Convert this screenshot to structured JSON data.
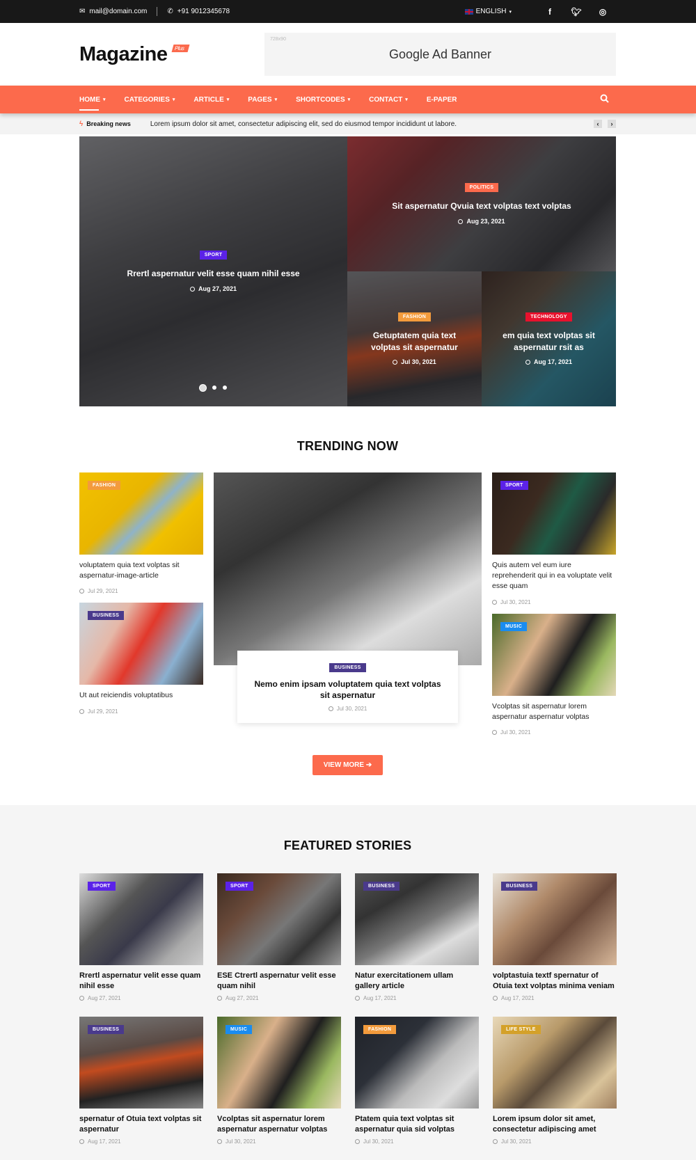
{
  "topbar": {
    "email": "mail@domain.com",
    "phone": "+91 9012345678",
    "language": "ENGLISH",
    "social": [
      "f",
      "t",
      "ig"
    ]
  },
  "header": {
    "logo": "Magazine",
    "logo_badge": "Plus",
    "ad_size": "728x90",
    "ad_text": "Google Ad Banner"
  },
  "nav": {
    "items": [
      {
        "label": "HOME",
        "dropdown": true,
        "active": true
      },
      {
        "label": "CATEGORIES",
        "dropdown": true
      },
      {
        "label": "ARTICLE",
        "dropdown": true
      },
      {
        "label": "PAGES",
        "dropdown": true
      },
      {
        "label": "SHORTCODES",
        "dropdown": true
      },
      {
        "label": "CONTACT",
        "dropdown": true
      },
      {
        "label": "E-PAPER",
        "dropdown": false
      }
    ]
  },
  "breaking": {
    "label": "Breaking news",
    "text": "Lorem ipsum dolor sit amet, consectetur adipiscing elit, sed do eiusmod tempor incididunt ut labore."
  },
  "colors": {
    "accent": "#fc6a4c",
    "sport": "#5b22e8",
    "politics": "#fc6a4c",
    "fashion": "#f39b3c",
    "technology": "#e8112d",
    "business": "#4a3a8c",
    "music": "#1a8cf0",
    "lifestyle": "#d4a12a"
  },
  "hero": [
    {
      "category": "SPORT",
      "title": "Rrertl aspernatur velit esse quam nihil esse",
      "date": "Aug 27, 2021"
    },
    {
      "category": "POLITICS",
      "title": "Sit aspernatur Qvuia text volptas text volptas",
      "date": "Aug 23, 2021"
    },
    {
      "category": "FASHION",
      "title": "Getuptatem quia text volptas sit aspernatur",
      "date": "Jul 30, 2021"
    },
    {
      "category": "TECHNOLOGY",
      "title": "em quia text volptas sit aspernatur rsit as",
      "date": "Aug 17, 2021"
    }
  ],
  "trending": {
    "title": "TRENDING NOW",
    "left": [
      {
        "category": "FASHION",
        "title": "voluptatem quia text volptas sit aspernatur-image-article",
        "date": "Jul 29, 2021"
      },
      {
        "category": "BUSINESS",
        "title": "Ut aut reiciendis voluptatibus",
        "date": "Jul 29, 2021"
      }
    ],
    "center": {
      "category": "BUSINESS",
      "title": "Nemo enim ipsam voluptatem quia text volptas sit aspernatur",
      "date": "Jul 30, 2021"
    },
    "right": [
      {
        "category": "SPORT",
        "title": "Quis autem vel eum iure reprehenderit qui in ea voluptate velit esse quam",
        "date": "Jul 30, 2021"
      },
      {
        "category": "MUSIC",
        "title": "Vcolptas sit aspernatur lorem aspernatur aspernatur volptas",
        "date": "Jul 30, 2021"
      }
    ],
    "view_more": "VIEW MORE"
  },
  "featured": {
    "title": "FEATURED STORIES",
    "items": [
      {
        "category": "SPORT",
        "title": "Rrertl aspernatur velit esse quam nihil esse",
        "date": "Aug 27, 2021"
      },
      {
        "category": "SPORT",
        "title": "ESE Ctrertl aspernatur velit esse quam nihil",
        "date": "Aug 27, 2021"
      },
      {
        "category": "BUSINESS",
        "title": "Natur exercitationem ullam gallery article",
        "date": "Aug 17, 2021"
      },
      {
        "category": "BUSINESS",
        "title": "volptastuia textf spernatur of Otuia text volptas minima veniam",
        "date": "Aug 17, 2021"
      },
      {
        "category": "BUSINESS",
        "title": "spernatur of Otuia text volptas sit aspernatur",
        "date": "Aug 17, 2021"
      },
      {
        "category": "MUSIC",
        "title": "Vcolptas sit aspernatur lorem aspernatur aspernatur volptas",
        "date": "Jul 30, 2021"
      },
      {
        "category": "FASHION",
        "title": "Ptatem quia text volptas sit aspernatur quia sid volptas",
        "date": "Jul 30, 2021"
      },
      {
        "category": "LIFE STYLE",
        "title": "Lorem ipsum dolor sit amet, consectetur adipiscing amet",
        "date": "Jul 30, 2021"
      }
    ]
  }
}
